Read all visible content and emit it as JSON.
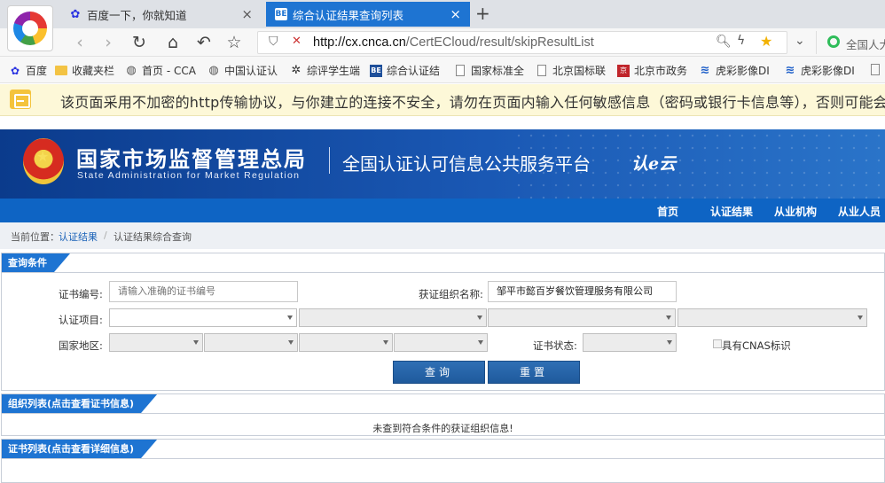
{
  "browser": {
    "tabs": [
      {
        "title": "百度一下，你就知道",
        "icon": "baidu-paw-icon",
        "active": false
      },
      {
        "title": "综合认证结果查询列表",
        "icon": "cert-site-icon",
        "active": true
      }
    ],
    "new_tab_label": "+",
    "close_glyph": "×",
    "url": {
      "host": "http://cx.cnca.cn",
      "path": "/CertECloud/result/skipResultList"
    },
    "search_engine_text": "全国人大",
    "bookmarks": [
      {
        "label": "百度",
        "icon": "baidu-paw-icon"
      },
      {
        "label": "收藏夹栏",
        "icon": "folder-icon"
      },
      {
        "label": "首页 - CCA",
        "icon": "globe-icon"
      },
      {
        "label": "中国认证认",
        "icon": "globe-icon"
      },
      {
        "label": "综评学生端",
        "icon": "star-icon"
      },
      {
        "label": "综合认证结",
        "icon": "cert-site-icon"
      },
      {
        "label": "国家标准全",
        "icon": "document-icon"
      },
      {
        "label": "北京国标联",
        "icon": "document-icon"
      },
      {
        "label": "北京市政务",
        "icon": "beijing-gov-icon"
      },
      {
        "label": "虎彩影像DI",
        "icon": "wave-icon"
      },
      {
        "label": "虎彩影像DI",
        "icon": "wave-icon"
      }
    ],
    "warning": "该页面采用不加密的http传输协议，与你建立的连接不安全，请勿在页面内输入任何敏感信息（密码或银行卡信息等），否则可能会"
  },
  "site": {
    "agency_cn": "国家市场监督管理总局",
    "agency_en": "State Administration  for  Market Regulation",
    "platform_title": "全国认证认可信息公共服务平台",
    "platform_logo": "认e云",
    "nav": [
      "首页",
      "认证结果",
      "从业机构",
      "从业人员"
    ],
    "breadcrumb": {
      "prefix": "当前位置：",
      "link": "认证结果",
      "sep": "/",
      "current": "认证结果综合查询"
    }
  },
  "query": {
    "panel_title": "查询条件",
    "cert_no_label": "证书编号:",
    "cert_no_placeholder": "请输入准确的证书编号",
    "org_name_label": "获证组织名称:",
    "org_name_value": "邹平市懿百岁餐饮管理服务有限公司",
    "project_label": "认证项目:",
    "region_label": "国家地区:",
    "status_label": "证书状态:",
    "cnas_label": "具有CNAS标识",
    "search_button": "查询",
    "reset_button": "重置"
  },
  "results": {
    "org_panel_title": "组织列表(点击查看证书信息)",
    "org_empty": "未查到符合条件的获证组织信息!",
    "cert_panel_title": "证书列表(点击查看详细信息)"
  },
  "colors": {
    "accent": "#1e74d2",
    "banner": "#0b3b8c",
    "nav": "#0e64c4",
    "warning_bg": "#fdf8d8"
  }
}
